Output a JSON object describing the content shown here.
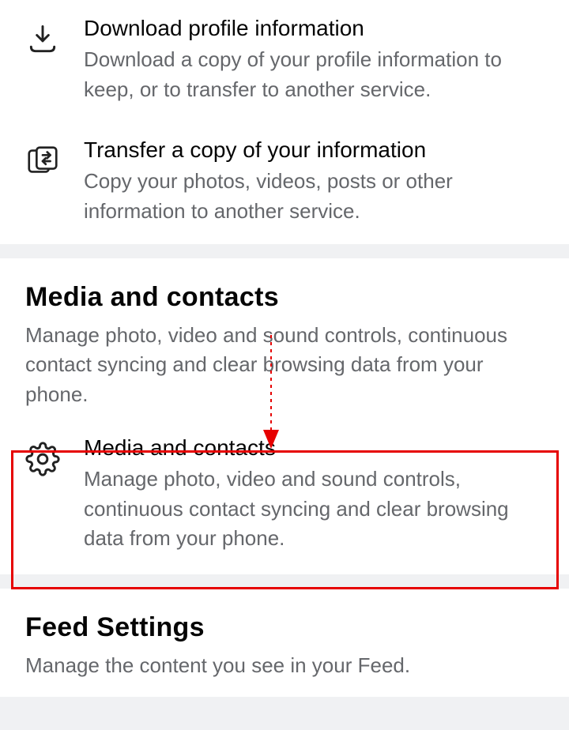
{
  "top_items": [
    {
      "title": "Download profile information",
      "desc": "Download a copy of your profile information to keep, or to transfer to another service.",
      "icon": "download-icon"
    },
    {
      "title": "Transfer a copy of your information",
      "desc": "Copy your photos, videos, posts or other information to another service.",
      "icon": "transfer-icon"
    }
  ],
  "media_section": {
    "title": "Media and contacts",
    "subtitle": "Manage photo, video and sound controls, continuous contact syncing and clear browsing data from your phone.",
    "item": {
      "title": "Media and contacts",
      "desc": "Manage photo, video and sound controls, continuous contact syncing and clear browsing data from your phone.",
      "icon": "gear-icon"
    }
  },
  "feed_section": {
    "title": "Feed Settings",
    "subtitle": "Manage the content you see in your Feed."
  },
  "annotation": {
    "box_color": "#e60000"
  }
}
